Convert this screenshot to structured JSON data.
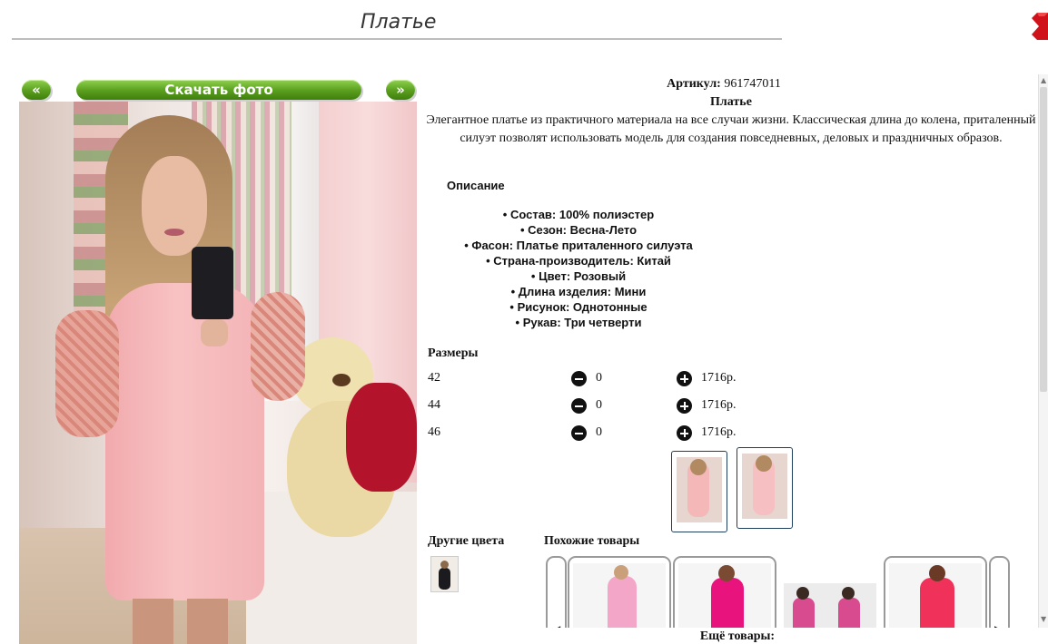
{
  "page": {
    "title": "Платье"
  },
  "header": {
    "close_icon": "close-icon",
    "close_color": "#d0121b"
  },
  "nav": {
    "prev_label": "«",
    "download_label": "Скачать фото",
    "next_label": "»",
    "button_color": "#5a9e1f"
  },
  "product": {
    "article_label": "Артикул:",
    "article_value": "961747011",
    "name": "Платье",
    "description": "Элегантное платье из практичного материала на все случаи жизни. Классическая длина до колена, приталенный силуэт позволят использовать модель для создания повседневных, деловых и праздничных образов.",
    "specs_heading": "Описание",
    "specs": [
      "Состав: 100% полиэстер",
      "Сезон: Весна-Лето",
      "Фасон: Платье приталенного силуэта",
      "Страна-производитель: Китай",
      "Цвет: Розовый",
      "Длина изделия: Мини",
      "Рисунок: Однотонные",
      "Рукав: Три четверти"
    ]
  },
  "sizes": {
    "heading": "Размеры",
    "rows": [
      {
        "size": "42",
        "qty": "0",
        "price": "1716р."
      },
      {
        "size": "44",
        "qty": "0",
        "price": "1716р."
      },
      {
        "size": "46",
        "qty": "0",
        "price": "1716р."
      }
    ],
    "minus_icon": "minus-circle-icon",
    "plus_icon": "plus-circle-icon"
  },
  "sections": {
    "other_colors": "Другие цвета",
    "similar": "Похожие товары",
    "more": "Ещё товары:"
  },
  "similar_colors": [
    "#f4a6c8",
    "#e8137c",
    "#d94b8f",
    "#f0325a"
  ]
}
